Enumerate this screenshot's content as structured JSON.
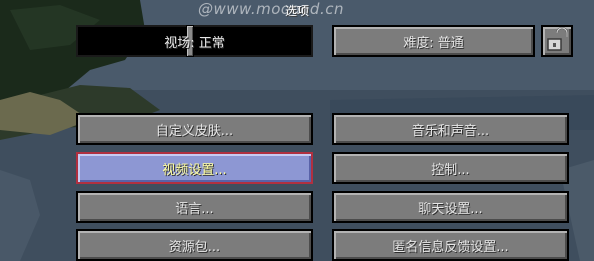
{
  "watermark": "@www.mooood.cn",
  "screen": {
    "title": "选项"
  },
  "difficulty_slider": {
    "label": "视场: 正常",
    "position": 0.48
  },
  "difficulty_button": {
    "label": "难度: 普通"
  },
  "lock_button": {
    "icon": "lock-icon",
    "state": "unlocked"
  },
  "buttons": {
    "skin": "自定义皮肤...",
    "sound": "音乐和声音...",
    "video": "视频设置...",
    "controls": "控制...",
    "language": "语言...",
    "chat": "聊天设置...",
    "resource_packs": "资源包...",
    "snooper": "匿名信息反馈设置..."
  },
  "colors": {
    "button_face": "#7c7c7c",
    "button_selected_face": "#8d97d3",
    "button_selected_border": "#b03040",
    "selected_text": "#ffffa0"
  }
}
